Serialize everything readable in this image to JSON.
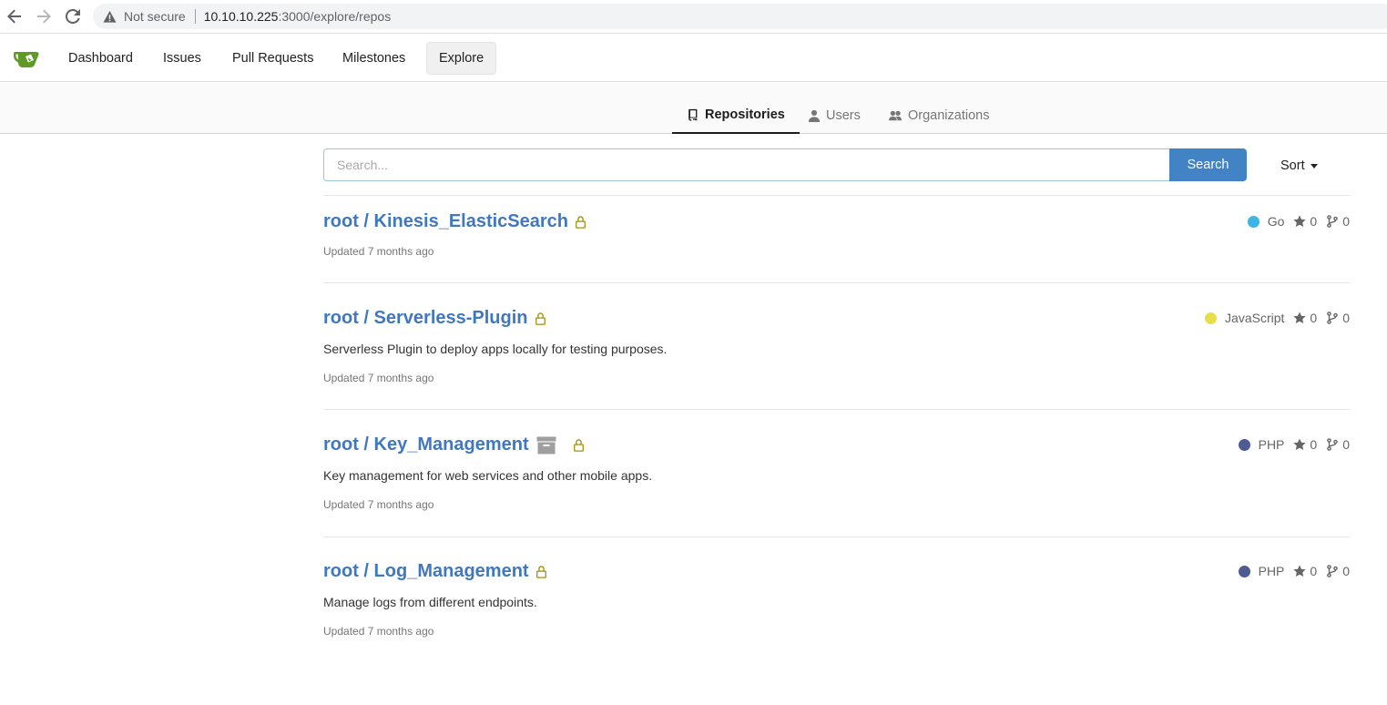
{
  "browser": {
    "not_secure": "Not secure",
    "host": "10.10.10.225",
    "path": ":3000/explore/repos"
  },
  "navbar": {
    "items": [
      {
        "label": "Dashboard"
      },
      {
        "label": "Issues"
      },
      {
        "label": "Pull Requests"
      },
      {
        "label": "Milestones"
      },
      {
        "label": "Explore",
        "active": true
      }
    ]
  },
  "tabs": [
    {
      "label": "Repositories",
      "icon": "repo-icon",
      "active": true
    },
    {
      "label": "Users",
      "icon": "user-icon"
    },
    {
      "label": "Organizations",
      "icon": "organization-icon"
    }
  ],
  "search": {
    "placeholder": "Search...",
    "value": "",
    "button_label": "Search",
    "sort_label": "Sort"
  },
  "repos": [
    {
      "title": "root / Kinesis_ElasticSearch",
      "description": "",
      "updated": "Updated 7 months ago",
      "language": "Go",
      "language_color": "#3cb4e6",
      "stars": "0",
      "forks": "0",
      "private": true,
      "archived": false
    },
    {
      "title": "root / Serverless-Plugin",
      "description": "Serverless Plugin to deploy apps locally for testing purposes.",
      "updated": "Updated 7 months ago",
      "language": "JavaScript",
      "language_color": "#e8de4a",
      "stars": "0",
      "forks": "0",
      "private": true,
      "archived": false
    },
    {
      "title": "root / Key_Management",
      "description": "Key management for web services and other mobile apps.",
      "updated": "Updated 7 months ago",
      "language": "PHP",
      "language_color": "#4f5b93",
      "stars": "0",
      "forks": "0",
      "private": true,
      "archived": true
    },
    {
      "title": "root / Log_Management",
      "description": "Manage logs from different endpoints.",
      "updated": "Updated 7 months ago",
      "language": "PHP",
      "language_color": "#4f5b93",
      "stars": "0",
      "forks": "0",
      "private": true,
      "archived": false
    }
  ],
  "colors": {
    "accent": "#4183c4",
    "link": "#4078c0",
    "lock": "#a0910c"
  }
}
